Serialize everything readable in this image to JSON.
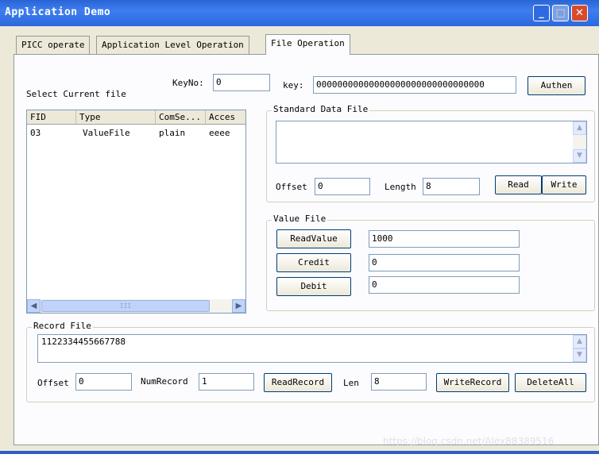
{
  "window": {
    "title": "Application Demo"
  },
  "tabs": [
    "PICC operate",
    "Application Level Operation",
    "File Operation"
  ],
  "select_file": {
    "label": "Select Current file",
    "keyno_label": "KeyNo:",
    "keyno_value": "0",
    "key_label": "key:",
    "key_value": "00000000000000000000000000000000",
    "authen_label": "Authen"
  },
  "file_list": {
    "columns": [
      "FID",
      "Type",
      "ComSe...",
      "Acces"
    ],
    "rows": [
      [
        "03",
        "ValueFile",
        "plain",
        "eeee"
      ]
    ],
    "scroll_thumb": "III"
  },
  "standard_data_file": {
    "legend": "Standard Data File",
    "data": "",
    "offset_label": "Offset",
    "offset_value": "0",
    "length_label": "Length",
    "length_value": "8",
    "read_label": "Read",
    "write_label": "Write"
  },
  "value_file": {
    "legend": "Value File",
    "readvalue_label": "ReadValue",
    "readvalue_value": "1000",
    "credit_label": "Credit",
    "credit_value": "0",
    "debit_label": "Debit",
    "debit_value": "0"
  },
  "record_file": {
    "legend": "Record File",
    "data": "1122334455667788",
    "offset_label": "Offset",
    "offset_value": "0",
    "numrecord_label": "NumRecord",
    "numrecord_value": "1",
    "readrecord_label": "ReadRecord",
    "len_label": "Len",
    "len_value": "8",
    "writerecord_label": "WriteRecord",
    "deleteall_label": "DeleteAll"
  },
  "watermark": "https://blog.csdn.net/Alex88389516",
  "colors": {
    "titlebar": "#2c68dc",
    "panel": "#fcfcfe",
    "face": "#ece9d8"
  }
}
